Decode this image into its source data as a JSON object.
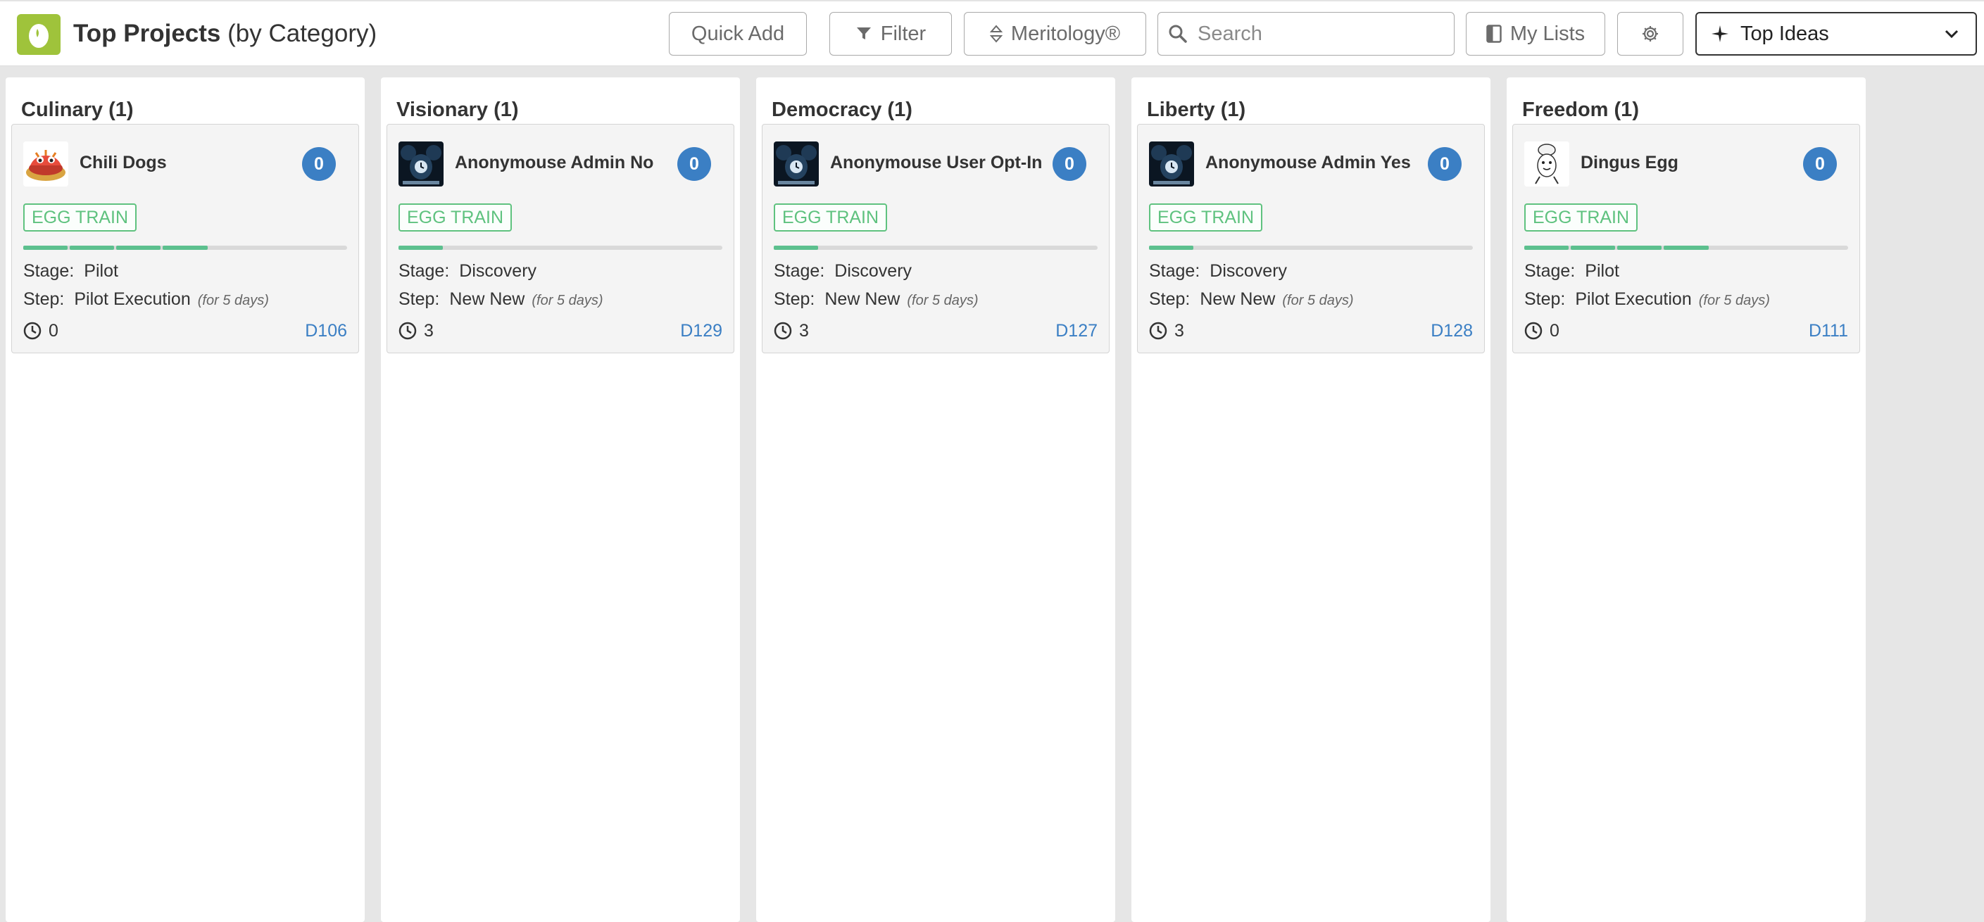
{
  "header": {
    "title_main": "Top Projects",
    "title_sub": " (by Category)",
    "quick_add_label": "Quick Add",
    "filter_label": "Filter",
    "meritology_label": "Meritology®",
    "search_placeholder": "Search",
    "my_lists_label": "My Lists",
    "view_select_label": "Top Ideas"
  },
  "colors": {
    "logo": "#9fc33b",
    "accent_blue": "#3b7fc4",
    "tag_green": "#5fc27f",
    "progress_green": "#5cc08e"
  },
  "columns": [
    {
      "title": "Culinary (1)",
      "card": {
        "title": "Chili Dogs",
        "avatar_icon": "chili-dog-icon",
        "count": "0",
        "tag": "EGG TRAIN",
        "progress_segments": 7,
        "progress_filled": 4,
        "stage_label": "Stage:",
        "stage": "Pilot",
        "step_label": "Step:",
        "step": "Pilot Execution",
        "step_note": "(for 5 days)",
        "time": "0",
        "code": "D106"
      }
    },
    {
      "title": "Visionary (1)",
      "card": {
        "title": "Anonymouse Admin No",
        "avatar_icon": "mouse-avatar-icon",
        "count": "0",
        "tag": "EGG TRAIN",
        "progress_segments": 7,
        "progress_filled": 1,
        "stage_label": "Stage:",
        "stage": "Discovery",
        "step_label": "Step:",
        "step": "New New",
        "step_note": "(for 5 days)",
        "time": "3",
        "code": "D129"
      }
    },
    {
      "title": "Democracy (1)",
      "card": {
        "title": "Anonymouse User Opt-In",
        "avatar_icon": "mouse-avatar-icon",
        "count": "0",
        "tag": "EGG TRAIN",
        "progress_segments": 7,
        "progress_filled": 1,
        "stage_label": "Stage:",
        "stage": "Discovery",
        "step_label": "Step:",
        "step": "New New",
        "step_note": "(for 5 days)",
        "time": "3",
        "code": "D127"
      }
    },
    {
      "title": "Liberty (1)",
      "card": {
        "title": "Anonymouse Admin Yes",
        "avatar_icon": "mouse-avatar-icon",
        "count": "0",
        "tag": "EGG TRAIN",
        "progress_segments": 7,
        "progress_filled": 1,
        "stage_label": "Stage:",
        "stage": "Discovery",
        "step_label": "Step:",
        "step": "New New",
        "step_note": "(for 5 days)",
        "time": "3",
        "code": "D128"
      }
    },
    {
      "title": "Freedom (1)",
      "card": {
        "title": "Dingus Egg",
        "avatar_icon": "egg-chef-icon",
        "count": "0",
        "tag": "EGG TRAIN",
        "progress_segments": 7,
        "progress_filled": 4,
        "stage_label": "Stage:",
        "stage": "Pilot",
        "step_label": "Step:",
        "step": "Pilot Execution",
        "step_note": "(for 5 days)",
        "time": "0",
        "code": "D111"
      }
    }
  ]
}
